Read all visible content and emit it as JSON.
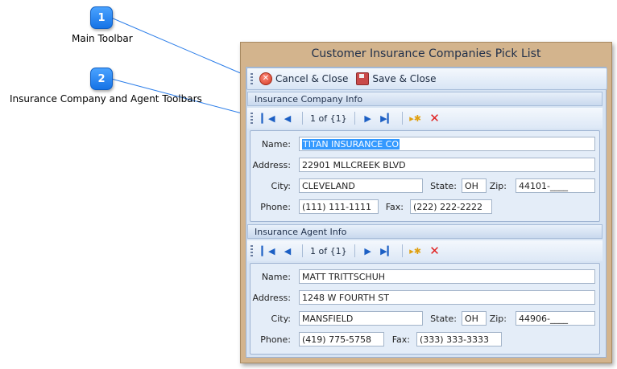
{
  "callouts": [
    {
      "number": "1",
      "label": "Main Toolbar"
    },
    {
      "number": "2",
      "label": "Insurance Company and Agent Toolbars"
    }
  ],
  "window": {
    "title": "Customer Insurance Companies Pick List",
    "toolbar": {
      "cancel_label": "Cancel & Close",
      "save_label": "Save & Close"
    }
  },
  "company": {
    "header": "Insurance Company Info",
    "nav_position": "1 of {1}",
    "labels": {
      "name": "Name:",
      "address": "Address:",
      "city": "City:",
      "state": "State:",
      "zip": "Zip:",
      "phone": "Phone:",
      "fax": "Fax:"
    },
    "values": {
      "name": "TITAN INSURANCE CO",
      "address": "22901 MLLCREEK BLVD",
      "city": "CLEVELAND",
      "state": "OH",
      "zip": "44101-____",
      "phone": "(111) 111-1111",
      "fax": "(222) 222-2222"
    }
  },
  "agent": {
    "header": "Insurance Agent Info",
    "nav_position": "1 of {1}",
    "labels": {
      "name": "Name:",
      "address": "Address:",
      "city": "City:",
      "state": "State:",
      "zip": "Zip:",
      "phone": "Phone:",
      "fax": "Fax:"
    },
    "values": {
      "name": "MATT TRITTSCHUH",
      "address": "1248 W FOURTH ST",
      "city": "MANSFIELD",
      "state": "OH",
      "zip": "44906-____",
      "phone": "(419) 775-5758",
      "fax": "(333) 333-3333"
    }
  },
  "icons": {
    "first": "first-record-icon",
    "prev": "previous-record-icon",
    "next": "next-record-icon",
    "last": "last-record-icon",
    "add": "add-new-icon",
    "delete": "delete-icon"
  },
  "colors": {
    "accent": "#1673e6",
    "window_frame": "#d3b48d",
    "selection": "#3399ff"
  }
}
